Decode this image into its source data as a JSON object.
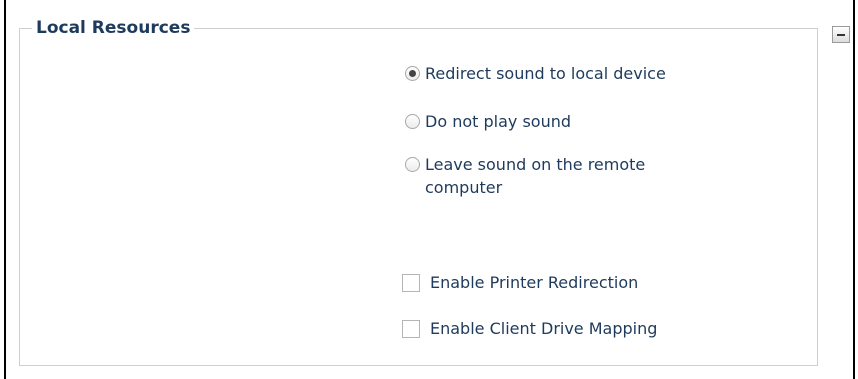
{
  "group": {
    "title": "Local Resources",
    "collapse_icon": "minus-icon"
  },
  "sound_options": [
    {
      "label": "Redirect sound to local device",
      "checked": true
    },
    {
      "label": "Do not play sound",
      "checked": false
    },
    {
      "label": "Leave sound on the remote computer",
      "checked": false
    }
  ],
  "checkbox_options": [
    {
      "label": "Enable Printer Redirection",
      "checked": false
    },
    {
      "label": "Enable Client Drive Mapping",
      "checked": false
    }
  ],
  "colors": {
    "text": "#1e3a5c",
    "group_border": "#cfcfcf"
  }
}
